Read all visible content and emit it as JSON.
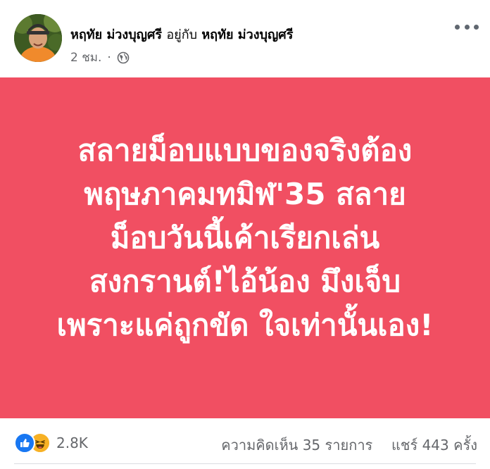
{
  "post": {
    "author": "หฤทัย ม่วงบุญศรี",
    "with_label": "อยู่กับ",
    "tagged": "หฤทัย ม่วงบุญศรี",
    "time": "2 ชม.",
    "dot": "·",
    "privacy_icon": "globe-icon",
    "lines": [
      "สลายม็อบแบบของจริงต้อง",
      "พฤษภาคมทมิฬ'35 สลาย",
      "ม็อบวันนี้เค้าเรียกเล่น",
      "สงกรานต์!ไอ้น้อง มึงเจ็บ",
      "เพราะแค่ถูกขัด ใจเท่านั้นเอง!"
    ],
    "background_color": "#f14f62"
  },
  "footer": {
    "reaction_icons": [
      "like-icon",
      "haha-icon"
    ],
    "reaction_count": "2.8K",
    "comments": "ความคิดเห็น 35 รายการ",
    "shares": "แชร์ 443 ครั้ง"
  }
}
